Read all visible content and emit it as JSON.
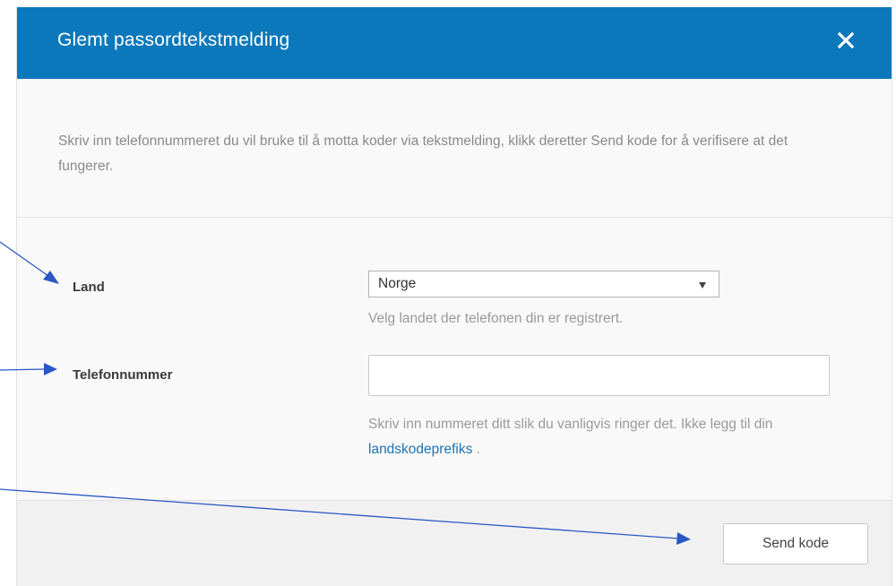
{
  "dialog": {
    "title": "Glemt passordtekstmelding",
    "intro": "Skriv inn telefonnummeret du vil bruke til å motta koder via tekstmelding, klikk deretter Send kode for å verifisere at det fungerer."
  },
  "form": {
    "country": {
      "label": "Land",
      "selected": "Norge",
      "help": "Velg landet der telefonen din er registrert."
    },
    "phone": {
      "label": "Telefonnummer",
      "value": "",
      "placeholder": "",
      "help_before": "Skriv inn nummeret ditt slik du vanligvis ringer det. Ikke legg til din ",
      "help_link": "landskodeprefiks",
      "help_after": " ."
    }
  },
  "footer": {
    "send_label": "Send kode"
  },
  "icons": {
    "close": "close-icon",
    "select_arrow": "caret-down-icon"
  },
  "colors": {
    "header": "#0b78bb",
    "link": "#1f72b0",
    "annotation_arrow": "#2a57c4"
  }
}
